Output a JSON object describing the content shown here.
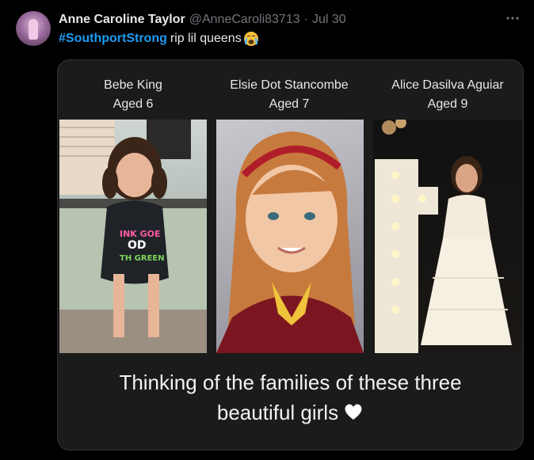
{
  "tweet": {
    "author_name": "Anne Caroline Taylor",
    "handle": "@AnneCaroli83713",
    "separator": "·",
    "date": "Jul 30",
    "hashtag": "#SouthportStrong",
    "text": "rip lil queens",
    "emoji_icon": "crying-face-icon",
    "more_icon": "more-icon"
  },
  "media": {
    "captions": [
      {
        "name": "Bebe King",
        "age": "Aged 6"
      },
      {
        "name": "Elsie Dot Stancombe",
        "age": "Aged 7"
      },
      {
        "name": "Alice Dasilva Aguiar",
        "age": "Aged 9"
      }
    ],
    "shirt_lines": [
      "INK GOE",
      "OD",
      "TH GREEN"
    ],
    "bottom_line1": "Thinking of the families of these three",
    "bottom_line2": "beautiful girls",
    "heart_icon": "white-heart-icon"
  },
  "colors": {
    "background": "#000000",
    "hashtag": "#1d9bf0",
    "text": "#e7e9ea",
    "muted": "#71767b"
  }
}
